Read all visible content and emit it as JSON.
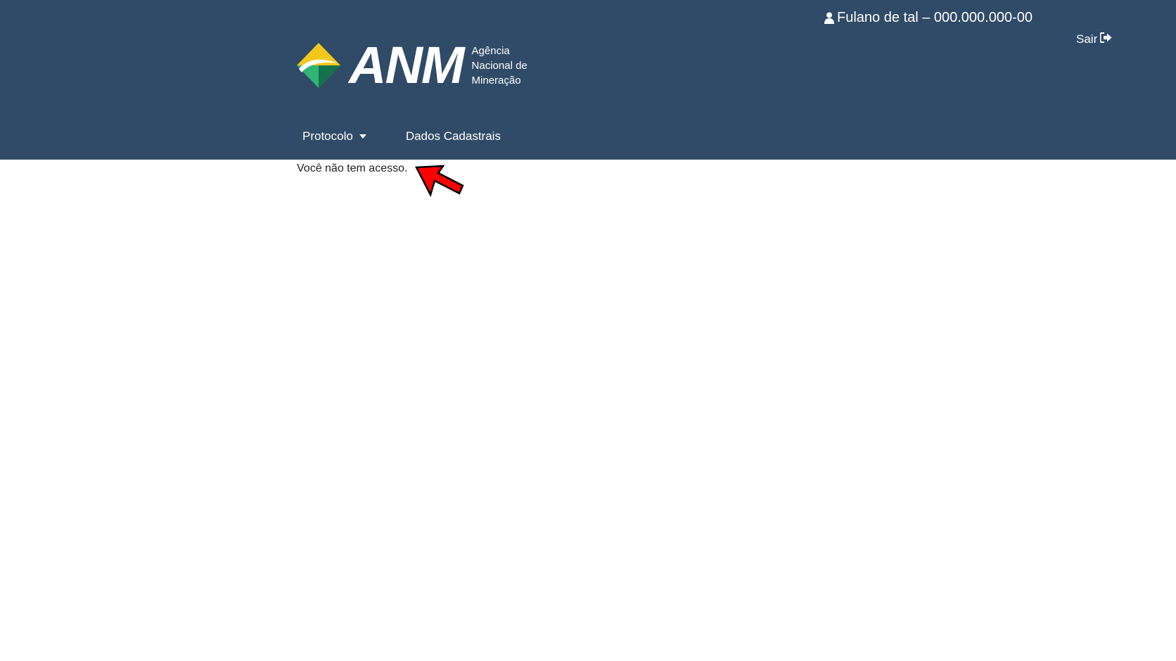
{
  "header": {
    "background_color": "#304b67",
    "user": {
      "icon": "user-icon",
      "label": "Fulano de tal – 000.000.000-00"
    },
    "logout": {
      "label": "Sair",
      "icon": "sign-out-icon"
    },
    "logo": {
      "acronym": "ANM",
      "name_lines": [
        "Agência",
        "Nacional de",
        "Mineração"
      ],
      "mark_colors": [
        "#f2c81b",
        "#1e9a5e",
        "#15734b",
        "#ffffff"
      ]
    },
    "nav": {
      "items": [
        {
          "label": "Protocolo",
          "dropdown": true
        },
        {
          "label": "Dados Cadastrais",
          "dropdown": false
        }
      ]
    }
  },
  "main": {
    "message": "Você não tem acesso.",
    "annotation": {
      "icon": "arrow-annotation-icon",
      "color": "#ff0000"
    }
  }
}
